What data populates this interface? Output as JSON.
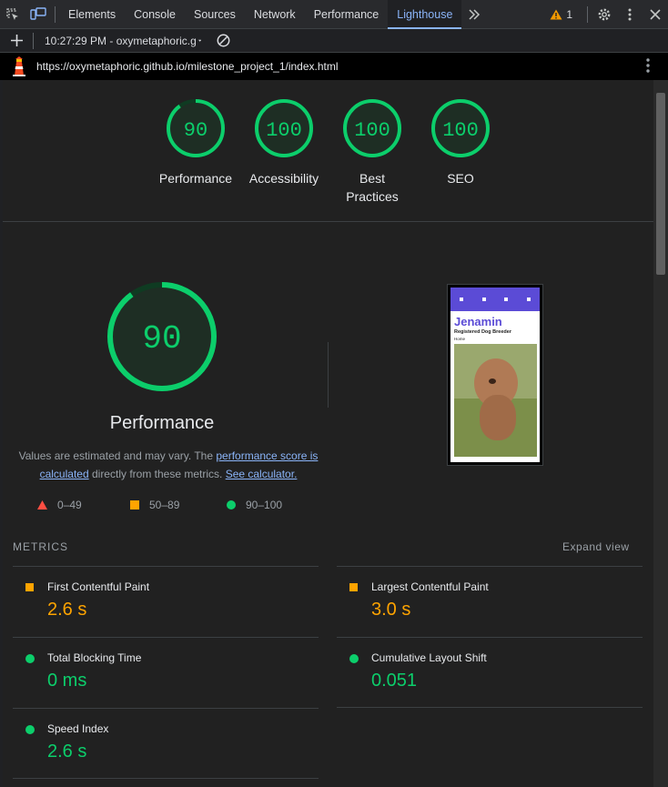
{
  "tabbar": {
    "tabs": [
      "Elements",
      "Console",
      "Sources",
      "Network",
      "Performance",
      "Lighthouse"
    ],
    "active": "Lighthouse",
    "warnings_count": "1"
  },
  "toolbar": {
    "report_label": "10:27:29 PM - oxymetaphoric.g"
  },
  "urlbar": {
    "url": "https://oxymetaphoric.github.io/milestone_project_1/index.html"
  },
  "scores": [
    {
      "value": "90",
      "label": "Performance",
      "fraction": 0.9
    },
    {
      "value": "100",
      "label": "Accessibility",
      "fraction": 1.0
    },
    {
      "value": "100",
      "label": "Best Practices",
      "fraction": 1.0
    },
    {
      "value": "100",
      "label": "SEO",
      "fraction": 1.0
    }
  ],
  "performance": {
    "score": "90",
    "fraction": 0.9,
    "title": "Performance",
    "disclaimer_prefix": "Values are estimated and may vary. The ",
    "link1": "performance score is calculated",
    "disclaimer_mid": " directly from these metrics. ",
    "link2": "See calculator."
  },
  "legend": [
    {
      "range": "0–49",
      "shape": "triangle",
      "color": "#ff4e42"
    },
    {
      "range": "50–89",
      "shape": "square",
      "color": "#ffa400"
    },
    {
      "range": "90–100",
      "shape": "circle",
      "color": "#0cce6b"
    }
  ],
  "thumbnail": {
    "site_title": "Jenamin",
    "site_subtitle": "Registered Dog Breeder",
    "nav": "Home"
  },
  "metrics": {
    "heading": "METRICS",
    "expand": "Expand view",
    "items": [
      {
        "name": "First Contentful Paint",
        "value": "2.6 s",
        "status": "average"
      },
      {
        "name": "Largest Contentful Paint",
        "value": "3.0 s",
        "status": "average"
      },
      {
        "name": "Total Blocking Time",
        "value": "0 ms",
        "status": "pass"
      },
      {
        "name": "Cumulative Layout Shift",
        "value": "0.051",
        "status": "pass"
      },
      {
        "name": "Speed Index",
        "value": "2.6 s",
        "status": "pass"
      }
    ]
  },
  "colors": {
    "pass": "#0cce6b",
    "average": "#ffa400",
    "fail": "#ff4e42",
    "accent": "#8ab4f8"
  }
}
